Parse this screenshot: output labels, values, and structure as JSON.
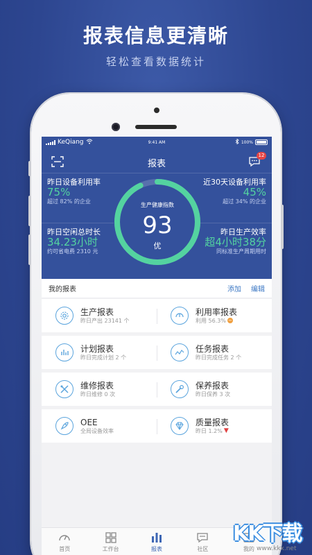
{
  "promo": {
    "title": "报表信息更清晰",
    "subtitle": "轻松查看数据统计"
  },
  "statusbar": {
    "carrier": "KeQiang",
    "time": "9:41 AM",
    "battery": "100%"
  },
  "nav": {
    "title": "报表",
    "badge": "12"
  },
  "stats": {
    "yesterday_utilization": {
      "label": "昨日设备利用率",
      "value": "75%",
      "sub": "超过 82% 的企业"
    },
    "month_utilization": {
      "label": "近30天设备利用率",
      "value": "45%",
      "sub": "超过 34% 的企业"
    },
    "idle_time": {
      "label": "昨日空闲总时长",
      "value": "34.23小时",
      "sub": "约可省电费 2310 元"
    },
    "production_eff": {
      "label": "昨日生产效率",
      "value": "超4小时38分",
      "sub": "同标准生产周期用时"
    }
  },
  "gauge": {
    "label": "生产健康指数",
    "value": "93",
    "grade": "优",
    "fraction": 0.93
  },
  "reports": {
    "title": "我的报表",
    "add": "添加",
    "edit": "编辑",
    "items": [
      {
        "title": "生产报表",
        "sub": "昨日产出 23141 个",
        "icon": "gear-icon"
      },
      {
        "title": "利用率报表",
        "sub": "利用 56.3%",
        "icon": "gauge-icon"
      },
      {
        "title": "计划报表",
        "sub": "昨日完成计划 2 个",
        "icon": "bar-chart-icon"
      },
      {
        "title": "任务报表",
        "sub": "昨日完成任务 2 个",
        "icon": "trend-icon"
      },
      {
        "title": "维修报表",
        "sub": "昨日维修 0 次",
        "icon": "tools-icon"
      },
      {
        "title": "保养报表",
        "sub": "昨日保养 3 次",
        "icon": "wrench-icon"
      },
      {
        "title": "OEE",
        "sub": "全局设备效率",
        "icon": "rocket-icon"
      },
      {
        "title": "质量报表",
        "sub": "昨日 1.2%",
        "icon": "diamond-icon"
      }
    ]
  },
  "tabs": [
    {
      "label": "首页",
      "icon": "speedometer-icon"
    },
    {
      "label": "工作台",
      "icon": "grid-icon"
    },
    {
      "label": "报表",
      "icon": "bar-chart-icon"
    },
    {
      "label": "社区",
      "icon": "chat-icon"
    },
    {
      "label": "我的",
      "icon": "user-icon"
    }
  ],
  "watermark": {
    "text": "KK下载",
    "url": "www.kkx.net"
  },
  "colors": {
    "header": "#34519c",
    "accent_green": "#54d3a0",
    "link_blue": "#3d78c4",
    "icon_blue": "#5aa4dd"
  }
}
